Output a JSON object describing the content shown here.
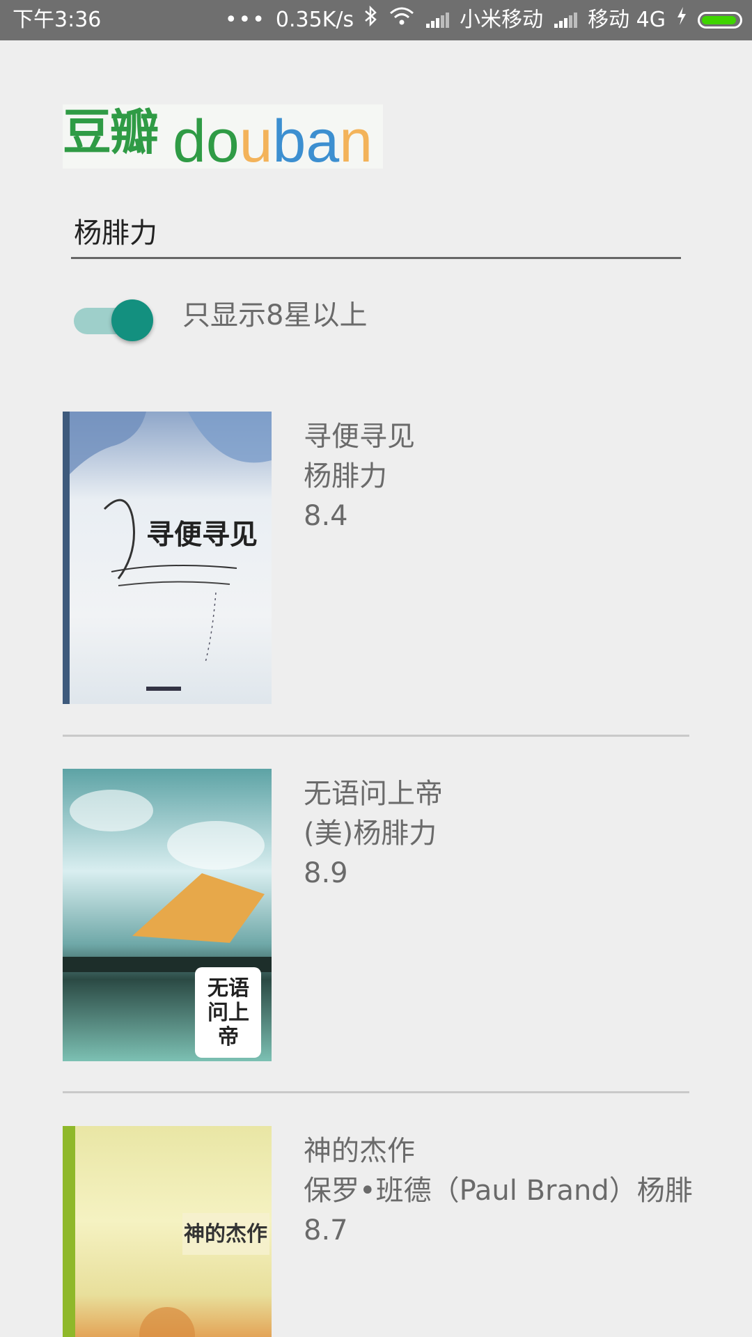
{
  "status_bar": {
    "time": "下午3:36",
    "dots": "•••",
    "speed": "0.35K/s",
    "carrier1": "小米移动",
    "carrier2": "移动 4G",
    "icons": [
      "bluetooth-icon",
      "wifi-icon",
      "signal-icon",
      "charging-icon",
      "battery-icon"
    ],
    "battery_color": "#3fd400"
  },
  "logo": {
    "cn": "豆瓣",
    "en_letters": [
      "d",
      "o",
      "u",
      "b",
      "a",
      "n"
    ]
  },
  "search": {
    "value": "杨腓力",
    "placeholder": ""
  },
  "filter": {
    "label": "只显示8星以上",
    "enabled": true,
    "accent": "#13907f"
  },
  "books": [
    {
      "title": "寻便寻见",
      "author": "杨腓力",
      "rating": "8.4",
      "cover_text": "寻便寻见"
    },
    {
      "title": "无语问上帝",
      "author": "(美)杨腓力",
      "rating": "8.9",
      "cover_text": "无语问上帝"
    },
    {
      "title": "神的杰作",
      "author": "保罗•班德（Paul Brand）杨腓",
      "rating": "8.7",
      "cover_text": "神的杰作"
    }
  ]
}
